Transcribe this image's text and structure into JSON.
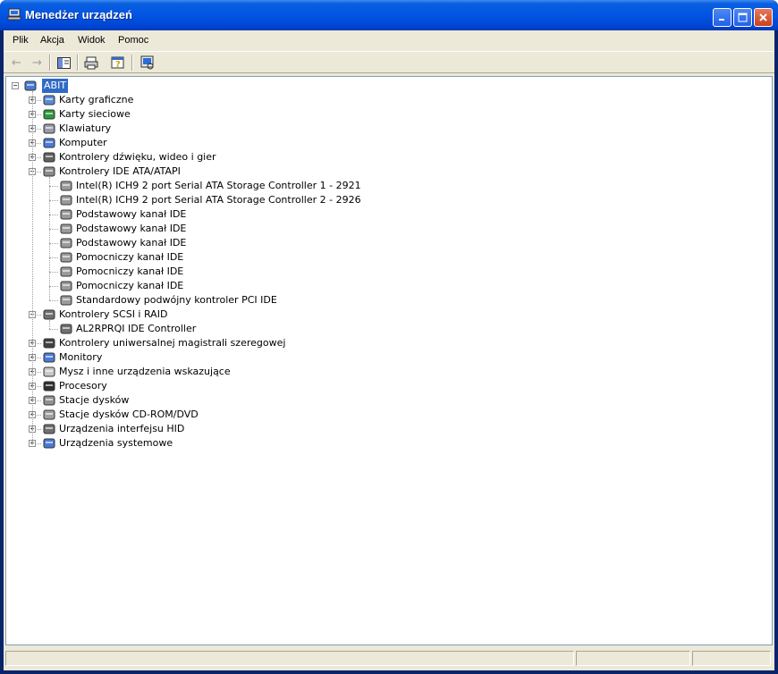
{
  "window": {
    "title": "Menedżer urządzeń"
  },
  "title_buttons": [
    "minimize-icon",
    "maximize-icon",
    "close-icon"
  ],
  "menu": [
    "Plik",
    "Akcja",
    "Widok",
    "Pomoc"
  ],
  "toolbar": [
    "back-arrow-icon",
    "forward-arrow-icon",
    "show-hide-tree-icon",
    "print-icon",
    "help-properties-icon",
    "scan-hardware-icon"
  ],
  "tree": {
    "root": "ABIT",
    "categories": [
      "Karty graficzne",
      "Karty sieciowe",
      "Klawiatury",
      "Komputer",
      "Kontrolery dźwięku, wideo i gier",
      "Kontrolery IDE ATA/ATAPI",
      "Kontrolery SCSI i RAID",
      "Kontrolery uniwersalnej magistrali szeregowej",
      "Monitory",
      "Mysz i inne urządzenia wskazujące",
      "Procesory",
      "Stacje dysków",
      "Stacje dysków CD-ROM/DVD",
      "Urządzenia interfejsu HID",
      "Urządzenia systemowe"
    ],
    "ide_children": [
      "Intel(R) ICH9 2 port Serial ATA Storage Controller 1 - 2921",
      "Intel(R) ICH9 2 port Serial ATA Storage Controller 2 - 2926",
      "Podstawowy kanał IDE",
      "Podstawowy kanał IDE",
      "Podstawowy kanał IDE",
      "Pomocniczy kanał IDE",
      "Pomocniczy kanał IDE",
      "Pomocniczy kanał IDE",
      "Standardowy podwójny kontroler PCI IDE"
    ],
    "scsi_children": [
      "AL2RPRQI IDE Controller"
    ],
    "expander_expanded": "−",
    "expander_collapsed": "+"
  },
  "colors": {
    "titlebar": "#0254e2",
    "selection": "#316ac5",
    "chrome": "#ece9d8"
  }
}
